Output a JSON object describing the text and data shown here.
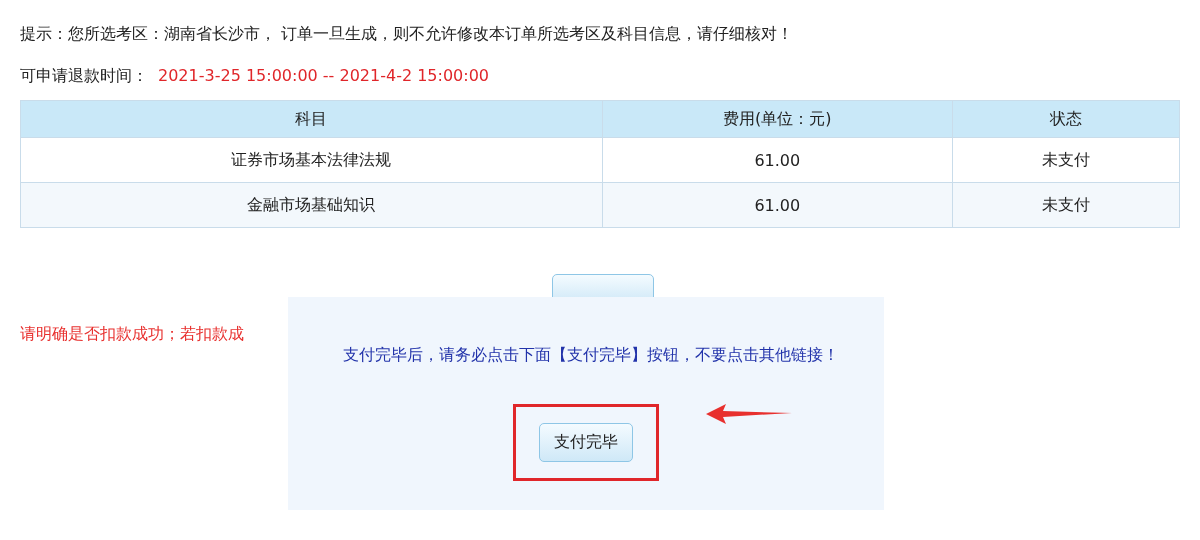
{
  "notice": "提示：您所选考区：湖南省长沙市， 订单一旦生成，则不允许修改本订单所选考区及科目信息，请仔细核对！",
  "refund_period": {
    "label": "可申请退款时间：",
    "value": "2021-3-25 15:00:00 -- 2021-4-2 15:00:00"
  },
  "table": {
    "columns": [
      "科目",
      "费用(单位：元)",
      "状态"
    ],
    "rows": [
      {
        "cells": [
          "证券市场基本法律法规",
          "61.00",
          "未支付"
        ]
      },
      {
        "cells": [
          "金融市场基础知识",
          "61.00",
          "未支付"
        ]
      }
    ]
  },
  "warning": "请明确是否扣款成功；若扣款成",
  "dialog": {
    "message": "支付完毕后，请务必点击下面【支付完毕】按钮，不要点击其他链接！",
    "button": "支付完毕",
    "highlighted": true
  }
}
